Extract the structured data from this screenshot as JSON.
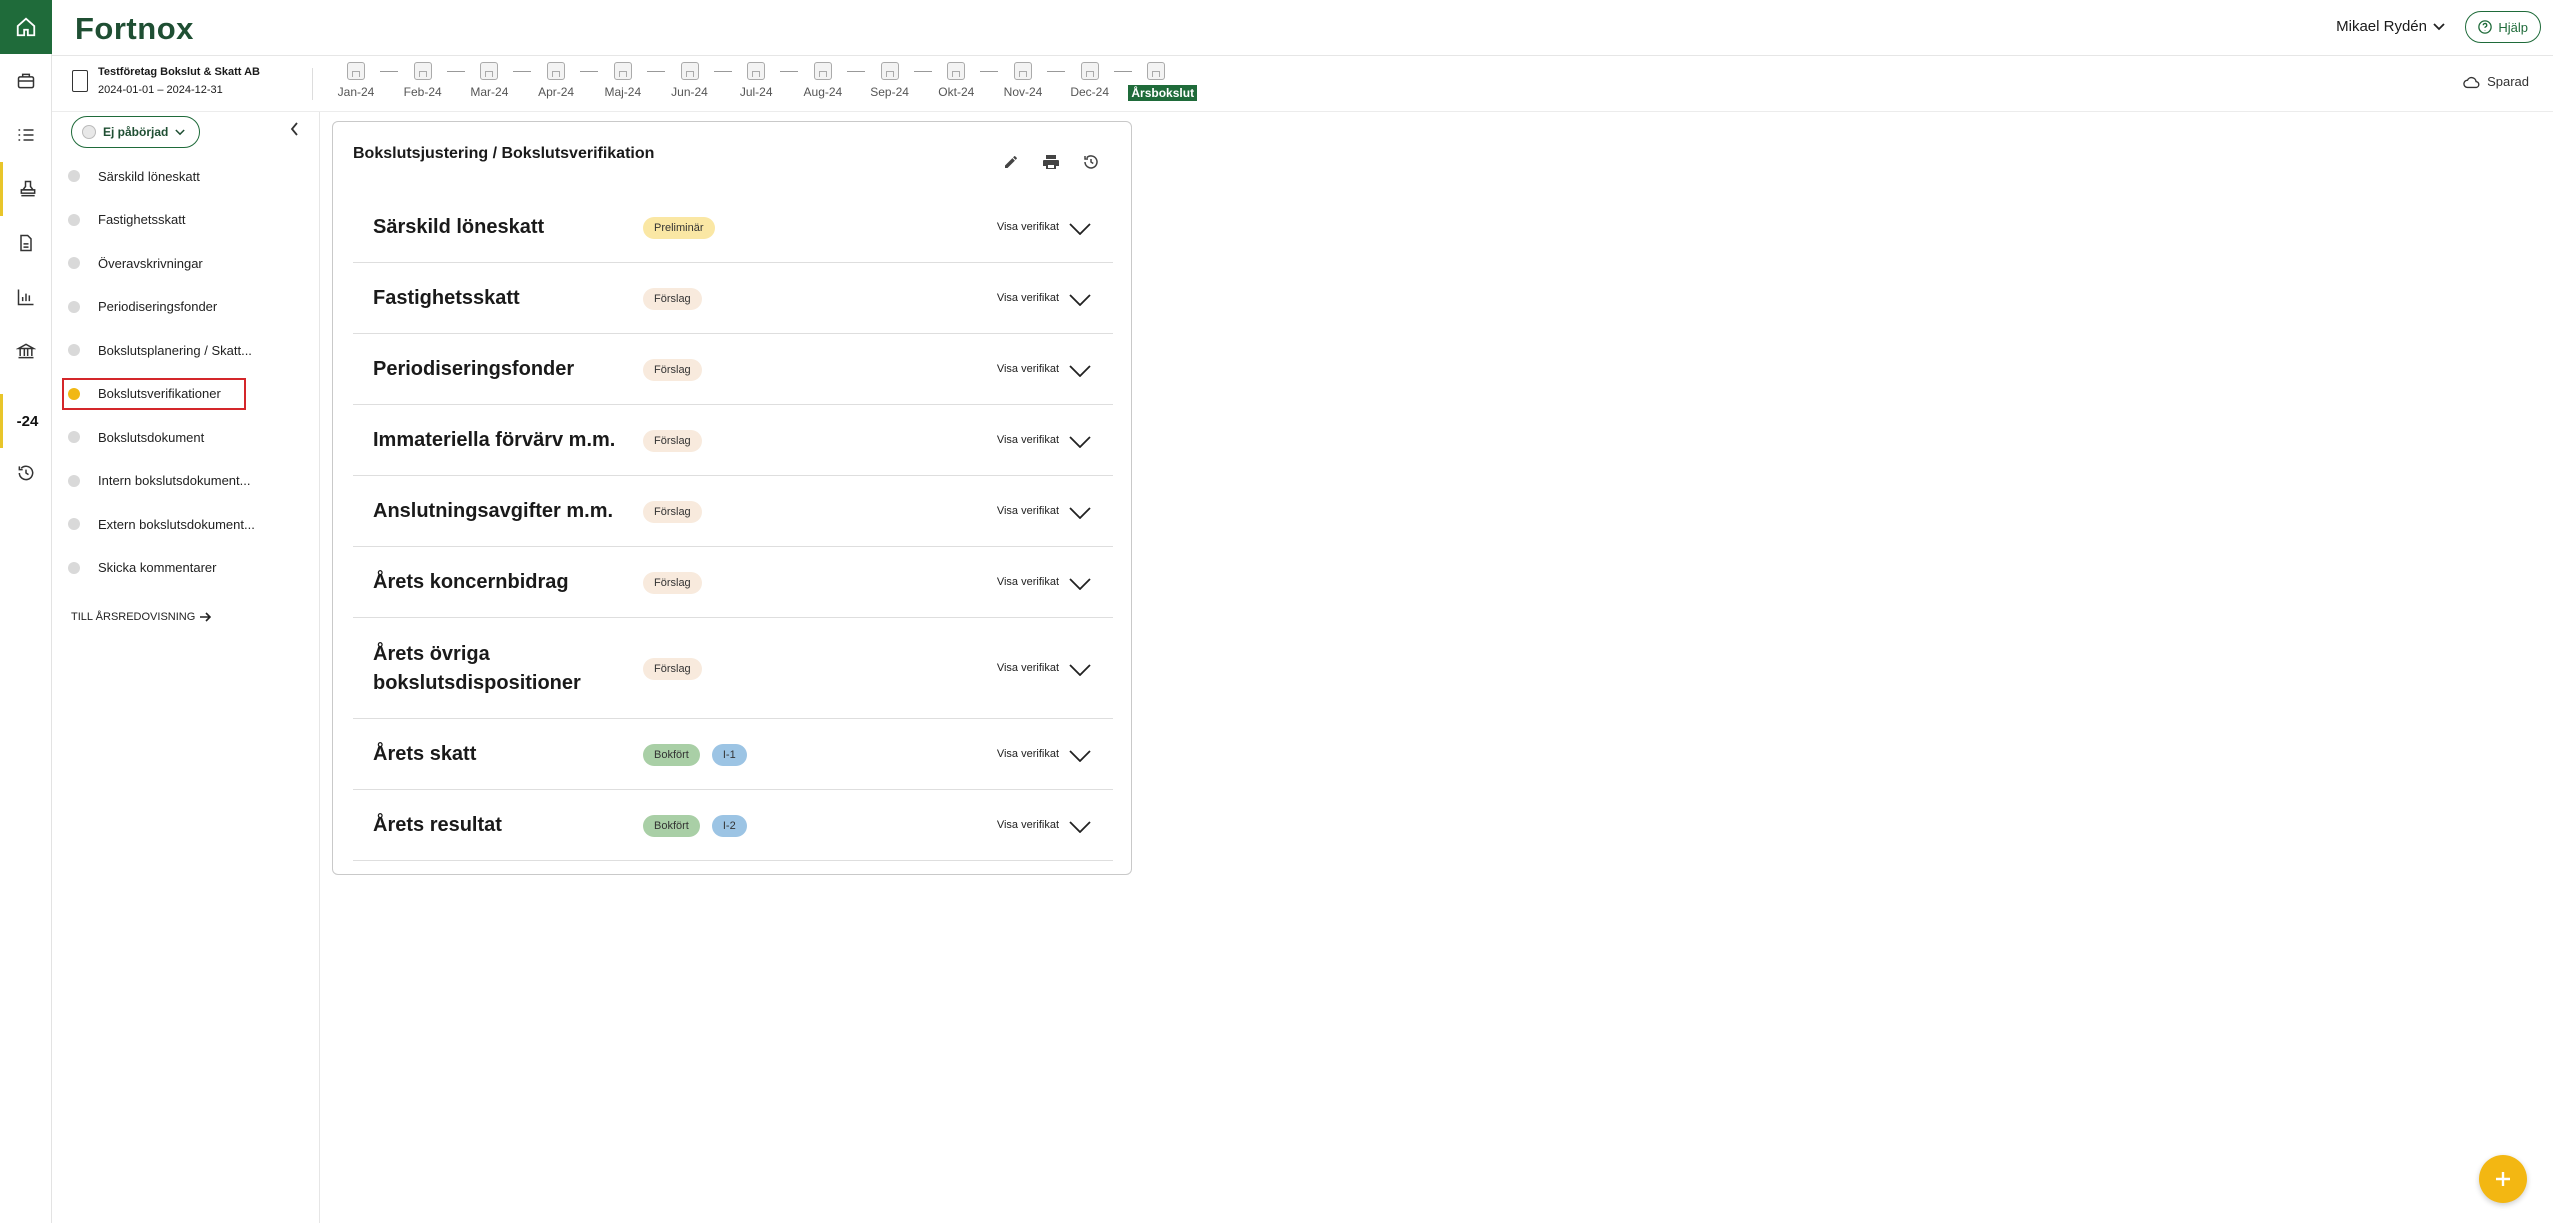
{
  "app": {
    "logo": "Fortnox"
  },
  "header": {
    "user_name": "Mikael Rydén",
    "help_label": "Hjälp"
  },
  "company": {
    "name": "Testföretag Bokslut & Skatt AB",
    "period": "2024-01-01 – 2024-12-31"
  },
  "timeline": {
    "months": [
      "Jan-24",
      "Feb-24",
      "Mar-24",
      "Apr-24",
      "Maj-24",
      "Jun-24",
      "Jul-24",
      "Aug-24",
      "Sep-24",
      "Okt-24",
      "Nov-24",
      "Dec-24",
      "Årsbokslut"
    ],
    "current": "Årsbokslut"
  },
  "saved_label": "Sparad",
  "rail": {
    "year_label": "-24"
  },
  "sidebar": {
    "status_label": "Ej påbörjad",
    "items": [
      {
        "label": "Särskild löneskatt"
      },
      {
        "label": "Fastighetsskatt"
      },
      {
        "label": "Överavskrivningar"
      },
      {
        "label": "Periodiseringsfonder"
      },
      {
        "label": "Bokslutsplanering / Skatt..."
      },
      {
        "label": "Bokslutsverifikationer"
      },
      {
        "label": "Bokslutsdokument"
      },
      {
        "label": "Intern bokslutsdokument..."
      },
      {
        "label": "Extern bokslutsdokument..."
      },
      {
        "label": "Skicka kommentarer"
      }
    ],
    "active_item": "Bokslutsverifikationer",
    "to_annual_label": "TILL ÅRSREDOVISNING"
  },
  "card": {
    "title": "Bokslutsjustering / Bokslutsverifikation",
    "show_label": "Visa verifikat",
    "rows": [
      {
        "title": "Särskild löneskatt",
        "status": "Preliminär"
      },
      {
        "title": "Fastighetsskatt",
        "status": "Förslag"
      },
      {
        "title": "Periodiseringsfonder",
        "status": "Förslag"
      },
      {
        "title": "Immateriella förvärv m.m.",
        "status": "Förslag"
      },
      {
        "title": "Anslutningsavgifter m.m.",
        "status": "Förslag"
      },
      {
        "title": "Årets koncernbidrag",
        "status": "Förslag"
      },
      {
        "title": "Årets övriga bokslutsdispositioner",
        "status": "Förslag"
      },
      {
        "title": "Årets skatt",
        "status": "Bokfört",
        "verification": "I-1"
      },
      {
        "title": "Årets resultat",
        "status": "Bokfört",
        "verification": "I-2"
      }
    ]
  },
  "colors": {
    "brand_green": "#1f6b3a",
    "accent_yellow": "#f3b712",
    "highlight_red": "#d4262a"
  },
  "icons": [
    "home-icon",
    "briefcase-icon",
    "checklist-icon",
    "stamp-icon",
    "document-icon",
    "chart-icon",
    "bank-icon",
    "history-icon",
    "user-chevron-icon",
    "help-icon",
    "cloud-icon",
    "building-icon",
    "pencil-icon",
    "printer-icon",
    "history-icon",
    "chevron-down-icon",
    "plus-icon"
  ]
}
